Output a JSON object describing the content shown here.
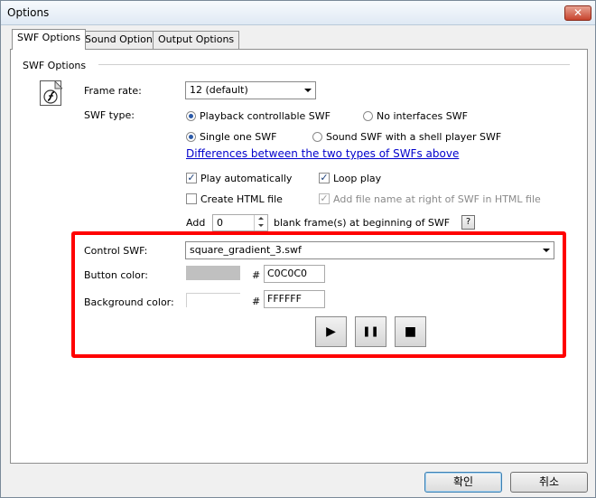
{
  "window": {
    "title": "Options",
    "close_glyph": "✕"
  },
  "tabs": [
    {
      "label": "SWF Options",
      "active": true
    },
    {
      "label": "Sound Options",
      "active": false
    },
    {
      "label": "Output Options",
      "active": false
    }
  ],
  "group": {
    "label": "SWF Options",
    "icon": "swf-file-icon"
  },
  "frame_rate": {
    "label": "Frame rate:",
    "value": "12 (default)"
  },
  "swf_type": {
    "label": "SWF type:",
    "option_playback": "Playback controllable SWF",
    "option_no_interfaces": "No interfaces SWF",
    "option_single": "Single one SWF",
    "option_sound_shell": "Sound SWF with a shell player SWF",
    "link": "Differences between the two types of SWFs above"
  },
  "options": {
    "play_automatically": "Play automatically",
    "loop_play": "Loop play",
    "create_html": "Create HTML file",
    "add_file_name": "Add file name at right of SWF in HTML file"
  },
  "blank_frames": {
    "prefix": "Add",
    "value": "0",
    "suffix": "blank frame(s) at beginning of SWF",
    "help": "?"
  },
  "control": {
    "control_swf_label": "Control SWF:",
    "control_swf_value": "square_gradient_3.swf",
    "button_color_label": "Button color:",
    "button_color_hash": "#",
    "button_color_value": "C0C0C0",
    "bg_color_label": "Background color:",
    "bg_color_hash": "#",
    "bg_color_value": "FFFFFF",
    "play_glyph": "▶",
    "pause_glyph": "❚❚",
    "stop_glyph": "■"
  },
  "colors": {
    "button_swatch": "#C0C0C0",
    "background_swatch": "#FFFFFF",
    "highlight": "#ff0000"
  },
  "footer": {
    "ok": "확인",
    "cancel": "취소"
  }
}
